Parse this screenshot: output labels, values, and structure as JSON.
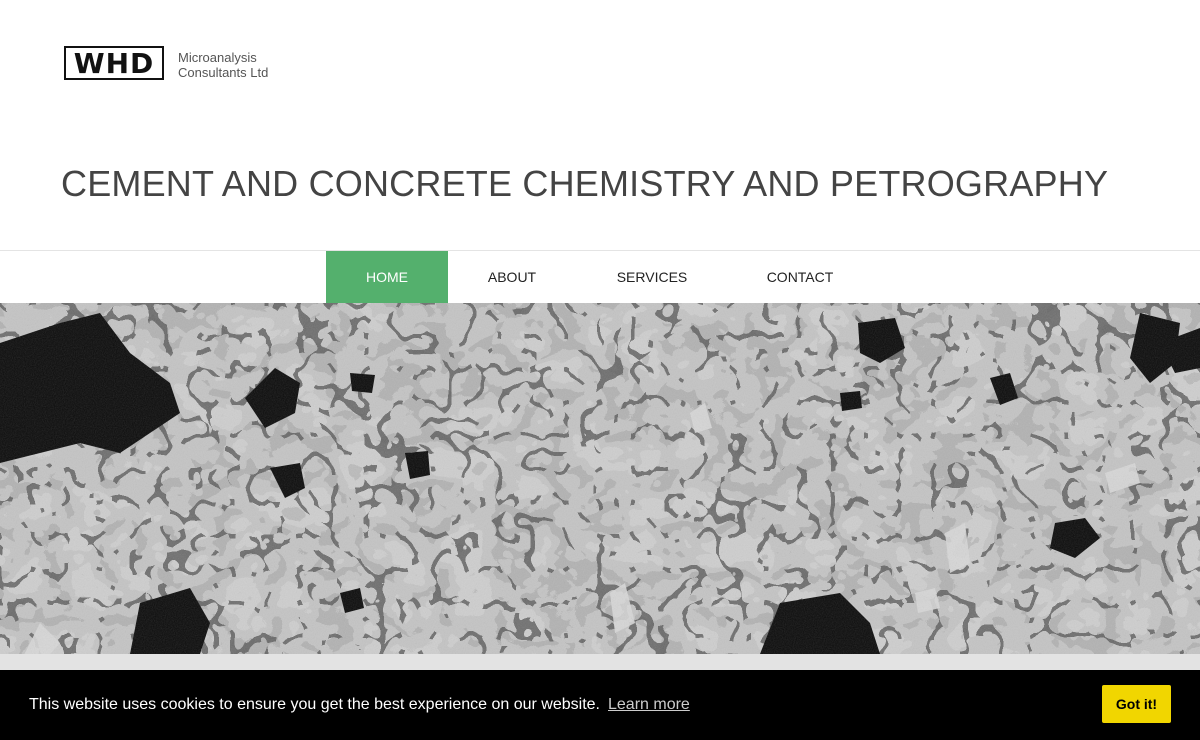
{
  "brand": {
    "logo_mark": "WHD",
    "company_line1": "Microanalysis",
    "company_line2": "Consultants Ltd"
  },
  "tagline": "CEMENT AND CONCRETE CHEMISTRY AND PETROGRAPHY",
  "nav": {
    "items": [
      {
        "label": "HOME",
        "active": true
      },
      {
        "label": "ABOUT",
        "active": false
      },
      {
        "label": "SERVICES",
        "active": false
      },
      {
        "label": "CONTACT",
        "active": false
      }
    ],
    "active_color": "#54b06d"
  },
  "cookie_banner": {
    "message": "This website uses cookies to ensure you get the best experience on our website.",
    "learn_more": "Learn more",
    "accept_label": "Got it!",
    "accept_color": "#f1d600"
  }
}
